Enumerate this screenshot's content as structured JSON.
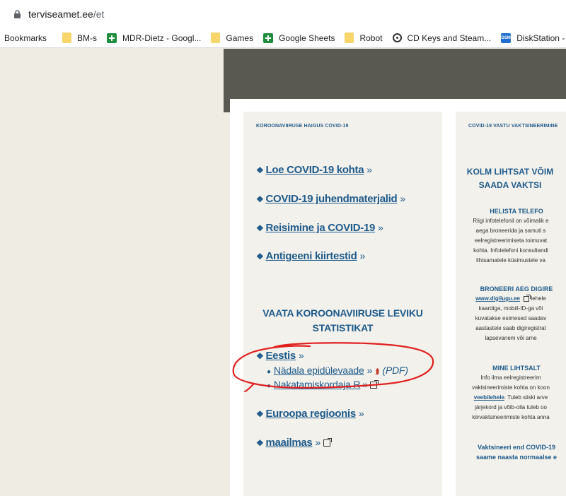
{
  "browser": {
    "url_host": "terviseamet.ee",
    "url_path": "/et",
    "bookmarks": [
      {
        "label": "Bookmarks",
        "icon": "none"
      },
      {
        "label": "BM-s",
        "icon": "folder-icon"
      },
      {
        "label": "MDR-Dietz - Googl...",
        "icon": "google-sheets-icon"
      },
      {
        "label": "Games",
        "icon": "folder-icon"
      },
      {
        "label": "Google Sheets",
        "icon": "google-sheets-icon"
      },
      {
        "label": "Robot",
        "icon": "folder-icon"
      },
      {
        "label": "CD Keys and Steam...",
        "icon": "location-pin-icon"
      },
      {
        "label": "DiskStation - Synol...",
        "icon": "dsm-icon",
        "icon_text": "DSM"
      }
    ]
  },
  "left_column": {
    "title": "KOROONAVIIRUSE HAIGUS COVID-19",
    "links": [
      {
        "label": "Loe COVID-19 kohta"
      },
      {
        "label": "COVID-19 juhendmaterjalid"
      },
      {
        "label": "Reisimine ja COVID-19"
      },
      {
        "label": "Antigeeni kiirtestid"
      }
    ],
    "stats_heading_line1": "VAATA KOROONAVIIRUSE LEVIKU",
    "stats_heading_line2": "STATISTIKAT",
    "estonia_link": "Eestis",
    "estonia_sublinks": [
      {
        "label": "Nädala epidülevaade",
        "suffix": "(PDF)"
      },
      {
        "label": "Nakatamiskordaja R"
      }
    ],
    "europe_link": "Euroopa regioonis",
    "world_link": "maailmas",
    "raquo": "»",
    "diamond": "❖",
    "bullet": "●"
  },
  "right_column": {
    "title": "COVID-19 VASTU VAKTSINEERIMINE",
    "heading_line1": "KOLM LIHTSAT VÕIM",
    "heading_line2": "SAADA VAKTSI",
    "section1_title": "HELISTA TELEFO",
    "section1_lines": [
      "Riigi infotelefonil on võimalik e",
      "aega broneerida ja samuti s",
      "eelregistreerimiseta toimuvat",
      "kohta. Infotelefoni konsultandi",
      "lihtsamatele küsimustele va"
    ],
    "section2_title": "BRONEERI AEG DIGIRE",
    "section2_link": "www.digilugu.ee",
    "section2_line1_rest": "lehele",
    "section2_lines": [
      "kaardiga, mobiil-ID-ga või",
      "kuvatakse esimesed saadav",
      "aastastele saab digiregistrat",
      "lapsevanem või ame"
    ],
    "section3_title": "MINE LIHTSALT",
    "section3_lines": [
      "Info ilma eelregistreerim",
      "vaktsineerimiste kohta on koon"
    ],
    "section3_link": "veebilehele",
    "section3_link_rest": ". Tuleb siiski arve",
    "section3_lines2": [
      "järjekord ja võib-olla tuleb oo",
      "kiirvaktsineerimiste kohta anna"
    ],
    "footer_line1": "Vaktsineeri end COVID-19",
    "footer_line2": "saame naasta normaalse e"
  },
  "colors": {
    "link_blue": "#1e5b8c",
    "annotation_red": "#e02020",
    "page_bg": "#efede3",
    "column_bg": "#f3f1eb",
    "dark_band": "#595952"
  }
}
